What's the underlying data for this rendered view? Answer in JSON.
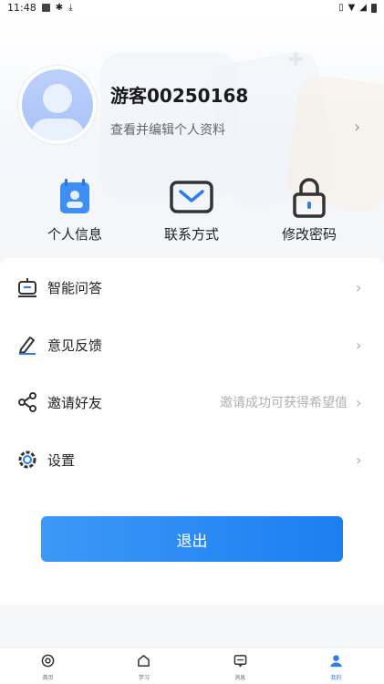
{
  "status_bar": {
    "time": "11:48"
  },
  "profile": {
    "username": "游客00250168",
    "edit_link": "查看并编辑个人资料"
  },
  "quick_actions": [
    {
      "label": "个人信息",
      "icon": "id-card-icon"
    },
    {
      "label": "联系方式",
      "icon": "envelope-icon"
    },
    {
      "label": "修改密码",
      "icon": "lock-icon"
    }
  ],
  "menu": [
    {
      "label": "智能问答",
      "hint": "",
      "icon": "robot-icon"
    },
    {
      "label": "意见反馈",
      "hint": "",
      "icon": "pen-icon"
    },
    {
      "label": "邀请好友",
      "hint": "邀请成功可获得希望值",
      "icon": "share-icon"
    },
    {
      "label": "设置",
      "hint": "",
      "icon": "gear-icon"
    }
  ],
  "logout_label": "退出",
  "bottom_nav": [
    {
      "label": "首页",
      "icon": "home-icon",
      "active": false
    },
    {
      "label": "学习",
      "icon": "study-icon",
      "active": false
    },
    {
      "label": "消息",
      "icon": "message-icon",
      "active": false
    },
    {
      "label": "我的",
      "icon": "user-icon",
      "active": true
    }
  ],
  "colors": {
    "accent": "#1b7ff0",
    "accent_light": "#3d98f7",
    "nav_active": "#2a7ef2"
  }
}
